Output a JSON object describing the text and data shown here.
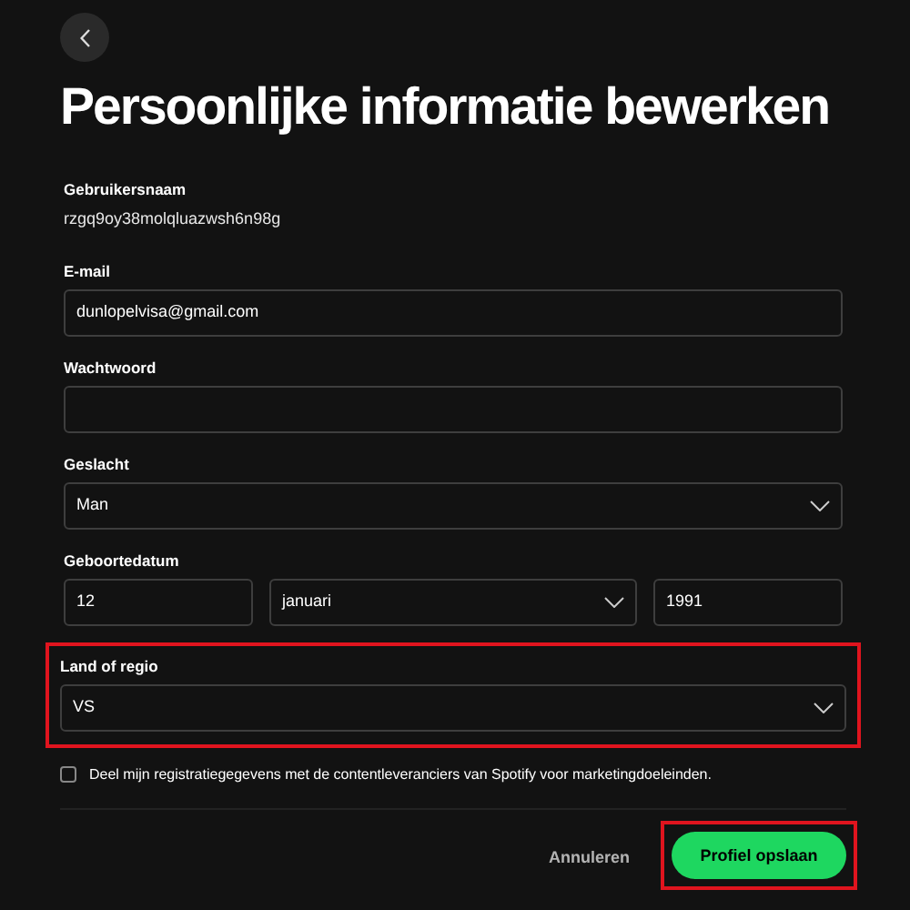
{
  "title": "Persoonlijke informatie bewerken",
  "fields": [
    {
      "kind": "text",
      "label": "Gebruikersnaam",
      "value": "rzgq9oy38molqluazwsh6n98g",
      "highlighted": false
    },
    {
      "kind": "input",
      "label": "E-mail",
      "value": "dunlopelvisa@gmail.com",
      "highlighted": false
    },
    {
      "kind": "input",
      "label": "Wachtwoord",
      "highlighted": false
    },
    {
      "kind": "select",
      "label": "Geslacht",
      "value": "Man",
      "highlighted": false
    },
    {
      "kind": "date",
      "label": "Geboortedatum",
      "day": "12",
      "month": "januari",
      "year": "1991",
      "highlighted": false
    },
    {
      "kind": "select",
      "label": "Land of regio",
      "value": "VS",
      "highlighted": true
    }
  ],
  "consent": {
    "label": "Deel mijn registratiegegevens met de contentleveranciers van Spotify voor marketingdoeleinden.",
    "checked": false
  },
  "buttons": [
    {
      "kind": "cancel",
      "label": "Annuleren",
      "highlighted": false
    },
    {
      "kind": "save",
      "label": "Profiel opslaan",
      "highlighted": true
    }
  ]
}
